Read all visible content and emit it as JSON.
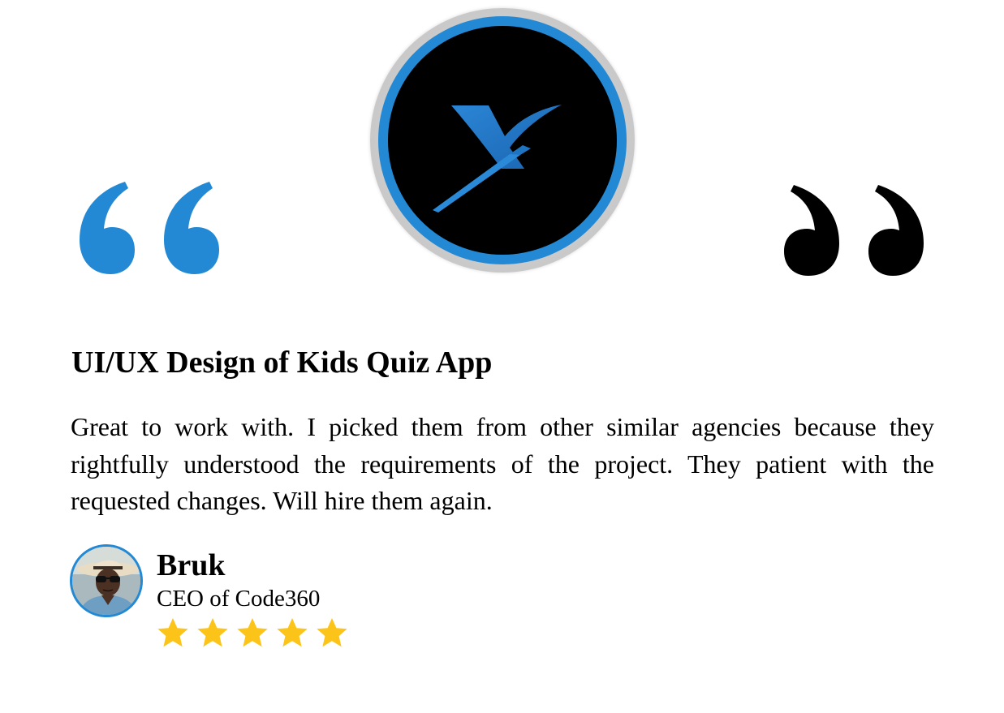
{
  "brand": {
    "logo_icon": "x-logo-icon",
    "accent_color": "#2389d4",
    "logo_background": "#000000"
  },
  "decor": {
    "open_quote_icon": "open-quote-icon",
    "open_quote_color": "#2389d4",
    "close_quote_icon": "close-quote-icon",
    "close_quote_color": "#000000"
  },
  "review": {
    "title": "UI/UX Design of Kids Quiz App",
    "body": "Great to work with. I picked them from other similar agencies because they rightfully understood the requirements of the project. They patient with the requested changes. Will hire them again."
  },
  "author": {
    "name": "Bruk",
    "role": "CEO of Code360",
    "avatar_icon": "avatar-photo"
  },
  "rating": {
    "value": 5,
    "max": 5,
    "star_icon": "star-icon",
    "star_color": "#fcc418"
  }
}
